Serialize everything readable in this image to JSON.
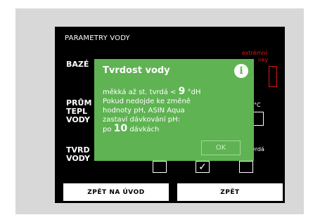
{
  "screen": {
    "title": "PARAMETRY VODY",
    "labels": {
      "pool": "BAZÉ",
      "temp_line1": "PRŮM",
      "temp_line2": "TEPL",
      "temp_line3": "VODY",
      "hardness_line1": "TVRD",
      "hardness_line2": "VODY"
    },
    "extreme_line1": "extrémní",
    "extreme_line2": "nky",
    "unit_celsius": "°C",
    "hardness_option": "vrdá",
    "checkmark": "✓"
  },
  "buttons": {
    "back_home": "ZPĚT NA ÚVOD",
    "back": "ZPĚT"
  },
  "dialog": {
    "title": "Tvrdost vody",
    "info_icon": "i",
    "line1_prefix": "měkká až st. tvrdá <",
    "line1_value": "9",
    "line1_unit": "°dH",
    "line2": "Pokud nedojde ke změně",
    "line3": "hodnoty pH, ASIN Aqua",
    "line4": "zastaví dávkování pH:",
    "line5_prefix": "po",
    "line5_value": "10",
    "line5_suffix": "dávkách",
    "ok_label": "OK"
  }
}
